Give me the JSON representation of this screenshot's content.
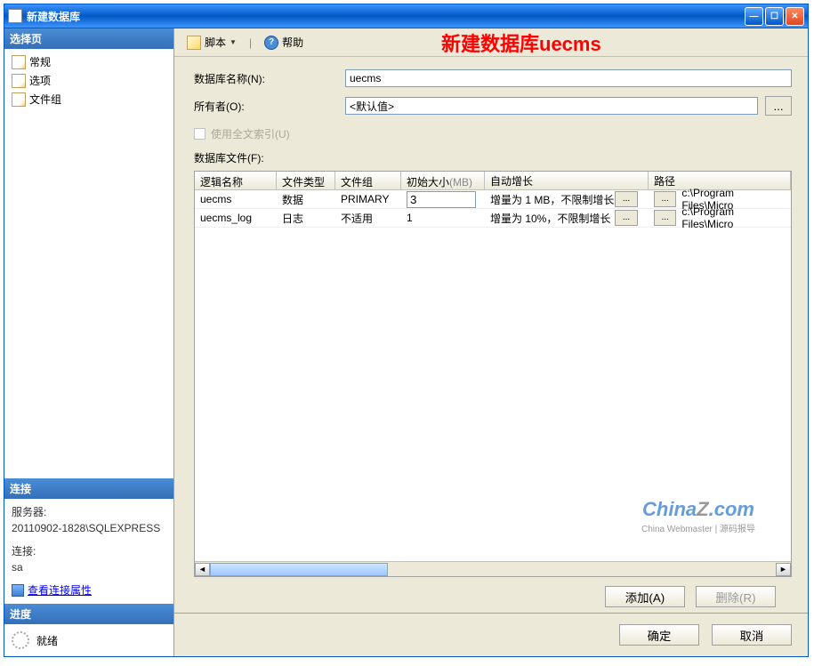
{
  "window": {
    "title": "新建数据库"
  },
  "sidebar": {
    "select_page_header": "选择页",
    "items": [
      {
        "label": "常规"
      },
      {
        "label": "选项"
      },
      {
        "label": "文件组"
      }
    ],
    "connection_header": "连接",
    "server_label": "服务器:",
    "server_value": "20110902-1828\\SQLEXPRESS",
    "conn_label": "连接:",
    "conn_value": "sa",
    "view_props_link": "查看连接属性",
    "progress_header": "进度",
    "progress_status": "就绪"
  },
  "toolbar": {
    "script_label": "脚本",
    "help_label": "帮助",
    "overlay_annotation": "新建数据库uecms"
  },
  "form": {
    "db_name_label": "数据库名称(N):",
    "db_name_value": "uecms",
    "owner_label": "所有者(O):",
    "owner_value": "<默认值>",
    "browse_text": "...",
    "fulltext_label": "使用全文索引(U)"
  },
  "files": {
    "section_label": "数据库文件(F):",
    "columns": {
      "logic_name": "逻辑名称",
      "file_type": "文件类型",
      "file_group": "文件组",
      "init_size_prefix": "初始大小",
      "init_size_unit": "(MB)",
      "autogrow": "自动增长",
      "path": "路径"
    },
    "rows": [
      {
        "logic": "uecms",
        "type": "数据",
        "group": "PRIMARY",
        "size": "3",
        "auto": "增量为 1 MB，不限制增长",
        "btn": "...",
        "path": "c:\\Program Files\\Micro"
      },
      {
        "logic": "uecms_log",
        "type": "日志",
        "group": "不适用",
        "size": "1",
        "auto": "增量为 10%，不限制增长",
        "btn": "...",
        "path": "c:\\Program Files\\Micro"
      }
    ]
  },
  "watermark": {
    "brand1": "China",
    "brand2": "Z",
    "brand3": ".com",
    "sub": "China Webmaster | 源码报导"
  },
  "actions": {
    "add": "添加(A)",
    "delete": "删除(R)"
  },
  "footer": {
    "ok": "确定",
    "cancel": "取消"
  }
}
